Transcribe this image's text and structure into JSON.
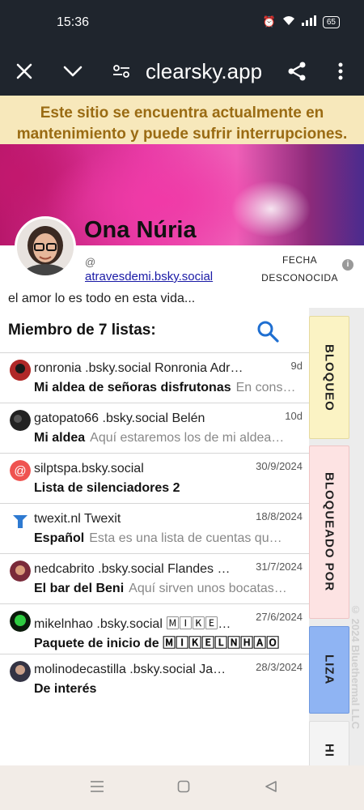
{
  "status_bar": {
    "time": "15:36",
    "battery": "65"
  },
  "browser": {
    "title": "clearsky.app"
  },
  "banner": {
    "text": "Este sitio se encuentra actualmente en mantenimiento y puede sufrir interrupciones."
  },
  "profile": {
    "name": "Ona Núria",
    "at_sign": "@",
    "handle": "atravesdemi.bsky.social",
    "date_line1": "FECHA",
    "date_line2": "DESCONOCIDA",
    "bio": "el amor lo es todo en esta vida..."
  },
  "lists": {
    "header": "Miembro de 7 listas:",
    "items": [
      {
        "title": "ronronia .bsky.social Ronronia Adrame…",
        "date": "9d",
        "list_name": "Mi aldea de señoras disfrutonas",
        "description": "En cons…"
      },
      {
        "title": "gatopato66 .bsky.social Belén",
        "date": "10d",
        "list_name": "Mi aldea",
        "description": "Aquí estaremos los de mi aldea…"
      },
      {
        "title": "silptspa.bsky.social",
        "date": "30/9/2024",
        "list_name": "Lista de silenciadores 2",
        "description": ""
      },
      {
        "title": "twexit.nl Twexit",
        "date": "18/8/2024",
        "list_name": "Español",
        "description": "Esta es una lista de cuentas qu…"
      },
      {
        "title": "nedcabrito .bsky.social Flandes …",
        "date": "31/7/2024",
        "list_name": "El bar del Beni",
        "description": "Aquí sirven unos bocatas…"
      },
      {
        "title": "mikelnhao .bsky.social 🄼🄸🄺🄴…",
        "date": "27/6/2024",
        "list_name": "Paquete de inicio de 🄼🄸🄺🄴🄻🄽🄷🄰🄾",
        "description": ""
      },
      {
        "title": "molinodecastilla .bsky.social Ja…",
        "date": "28/3/2024",
        "list_name": "De interés",
        "description": ""
      }
    ]
  },
  "side_tabs": [
    {
      "label": "BLOQUEO",
      "color": "#fbf3c4"
    },
    {
      "label": "BLOQUEADO POR",
      "color": "#fde3e3"
    },
    {
      "label": "LIZA",
      "color": "#8fb4f3"
    },
    {
      "label": "HI",
      "color": "#f4f4f4"
    }
  ],
  "copyright": "© 2024 Bluethermal LLC"
}
